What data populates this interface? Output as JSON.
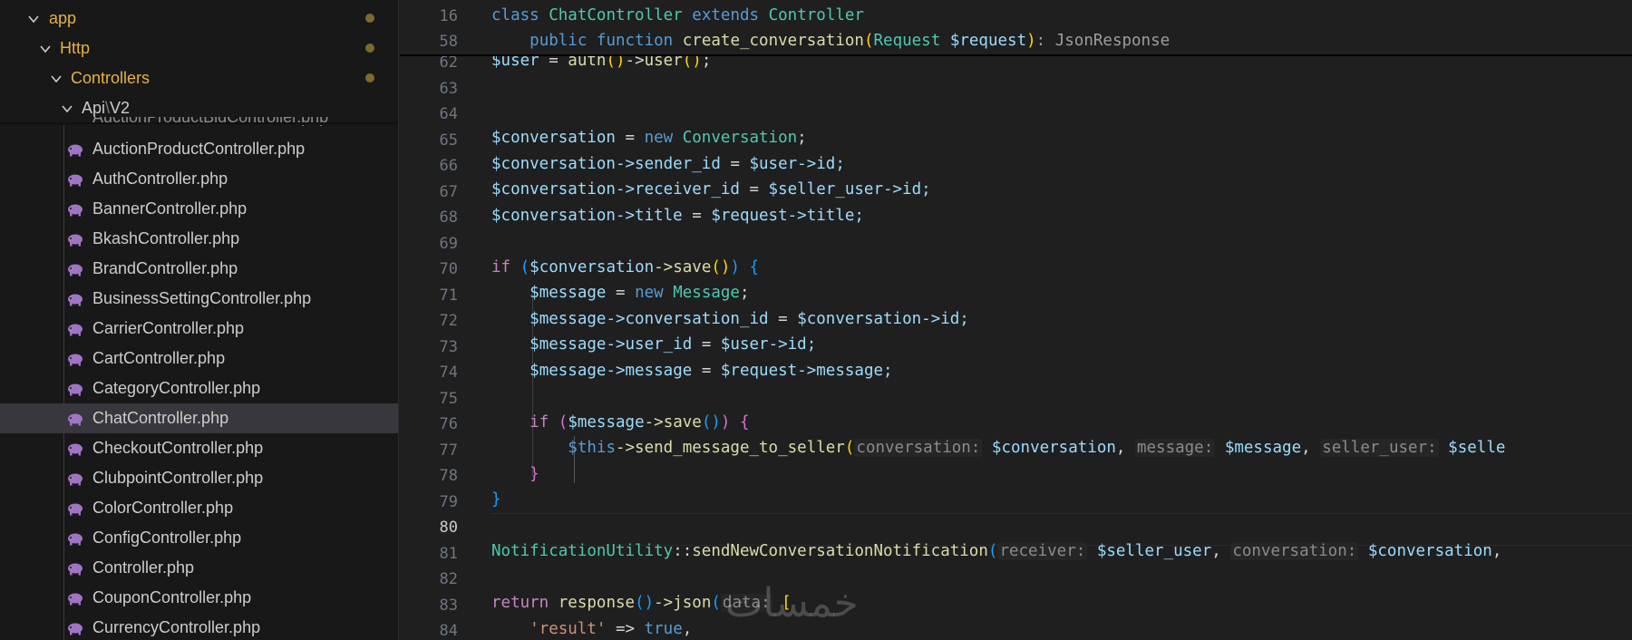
{
  "explorer": {
    "folders": [
      {
        "label": "app",
        "modified": true
      },
      {
        "label": "Http",
        "modified": true
      },
      {
        "label": "Controllers",
        "modified": true
      }
    ],
    "api_folder": {
      "part1": "Api",
      "sep": "\\",
      "part2": "V2"
    },
    "partial_file": "AuctionProductBidController.php",
    "files": [
      "AuctionProductController.php",
      "AuthController.php",
      "BannerController.php",
      "BkashController.php",
      "BrandController.php",
      "BusinessSettingController.php",
      "CarrierController.php",
      "CartController.php",
      "CategoryController.php",
      "ChatController.php",
      "CheckoutController.php",
      "ClubpointController.php",
      "ColorController.php",
      "ConfigController.php",
      "Controller.php",
      "CouponController.php",
      "CurrencyController.php"
    ],
    "selected_file": "ChatController.php"
  },
  "editor": {
    "sticky": [
      {
        "line": "16",
        "kw1": "class",
        "cls": "ChatController",
        "kw2": "extends",
        "base": "Controller"
      },
      {
        "line": "58",
        "kw1": "public",
        "kw2": "function",
        "fn": "create_conversation",
        "type": "Request",
        "param": "$request",
        "ret": ": JsonResponse"
      }
    ],
    "line_numbers": [
      "62",
      "63",
      "64",
      "65",
      "66",
      "67",
      "68",
      "69",
      "70",
      "71",
      "72",
      "73",
      "74",
      "75",
      "76",
      "77",
      "78",
      "79",
      "80",
      "81",
      "82",
      "83",
      "84"
    ],
    "current_line": "80",
    "lines": {
      "l62": {
        "v": "$user",
        "op": " = ",
        "fn": "auth",
        "arrow": "->",
        "fn2": "user"
      },
      "l65": {
        "v": "$conversation",
        "op": " = ",
        "kw": "new",
        "cls": "Conversation"
      },
      "l66": {
        "v": "$conversation",
        "prop": "->sender_id",
        "op": " = ",
        "v2": "$user",
        "prop2": "->id;"
      },
      "l67": {
        "v": "$conversation",
        "prop": "->receiver_id",
        "op": " = ",
        "v2": "$seller_user",
        "prop2": "->id;"
      },
      "l68": {
        "v": "$conversation",
        "prop": "->title",
        "op": " = ",
        "v2": "$request",
        "prop2": "->title;"
      },
      "l70": {
        "kw": "if",
        "v": "$conversation",
        "m": "->save",
        "tail": " {"
      },
      "l71": {
        "v": "$message",
        "op": " = ",
        "kw": "new",
        "cls": "Message"
      },
      "l72": {
        "v": "$message",
        "prop": "->conversation_id",
        "op": " = ",
        "v2": "$conversation",
        "prop2": "->id;"
      },
      "l73": {
        "v": "$message",
        "prop": "->user_id",
        "op": " = ",
        "v2": "$user",
        "prop2": "->id;"
      },
      "l74": {
        "v": "$message",
        "prop": "->message",
        "op": " = ",
        "v2": "$request",
        "prop2": "->message;"
      },
      "l76": {
        "kw": "if",
        "v": "$message",
        "m": "->save",
        "tail": " {"
      },
      "l77": {
        "v": "$this",
        "m": "->send_message_to_seller",
        "h1": "conversation:",
        "a1": "$conversation",
        "h2": "message:",
        "a2": "$message",
        "h3": "seller_user:",
        "a3": "$selle"
      },
      "l78": {
        "txt": "}"
      },
      "l79": {
        "txt": "}"
      },
      "l81": {
        "cls": "NotificationUtility",
        "sep": "::",
        "m": "sendNewConversationNotification",
        "h1": "receiver:",
        "a1": "$seller_user",
        "h2": "conversation:",
        "a2": "$conversation"
      },
      "l83": {
        "kw": "return",
        "fn": "response",
        "m": "->json",
        "h1": "data:",
        "br": "["
      },
      "l84": {
        "s": "'result'",
        "op": " => ",
        "kw": "true"
      }
    }
  },
  "watermark": "خمسات"
}
